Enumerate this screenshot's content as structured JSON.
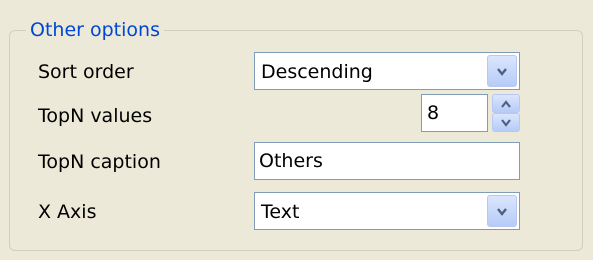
{
  "group": {
    "title": "Other options"
  },
  "sort_order": {
    "label": "Sort order",
    "value": "Descending"
  },
  "topn_values": {
    "label": "TopN values",
    "value": "8"
  },
  "topn_caption": {
    "label": "TopN caption",
    "value": "Others"
  },
  "x_axis": {
    "label": "X Axis",
    "value": "Text"
  },
  "icons": {
    "dropdown": "chevron-down-icon",
    "spin_up": "arrow-up-icon",
    "spin_down": "arrow-down-icon"
  },
  "colors": {
    "legend_text": "#0046d5",
    "field_border": "#7f9db9",
    "button_top": "#dbe6fd",
    "button_bottom": "#b6cbf7",
    "glyph": "#4d6185"
  }
}
